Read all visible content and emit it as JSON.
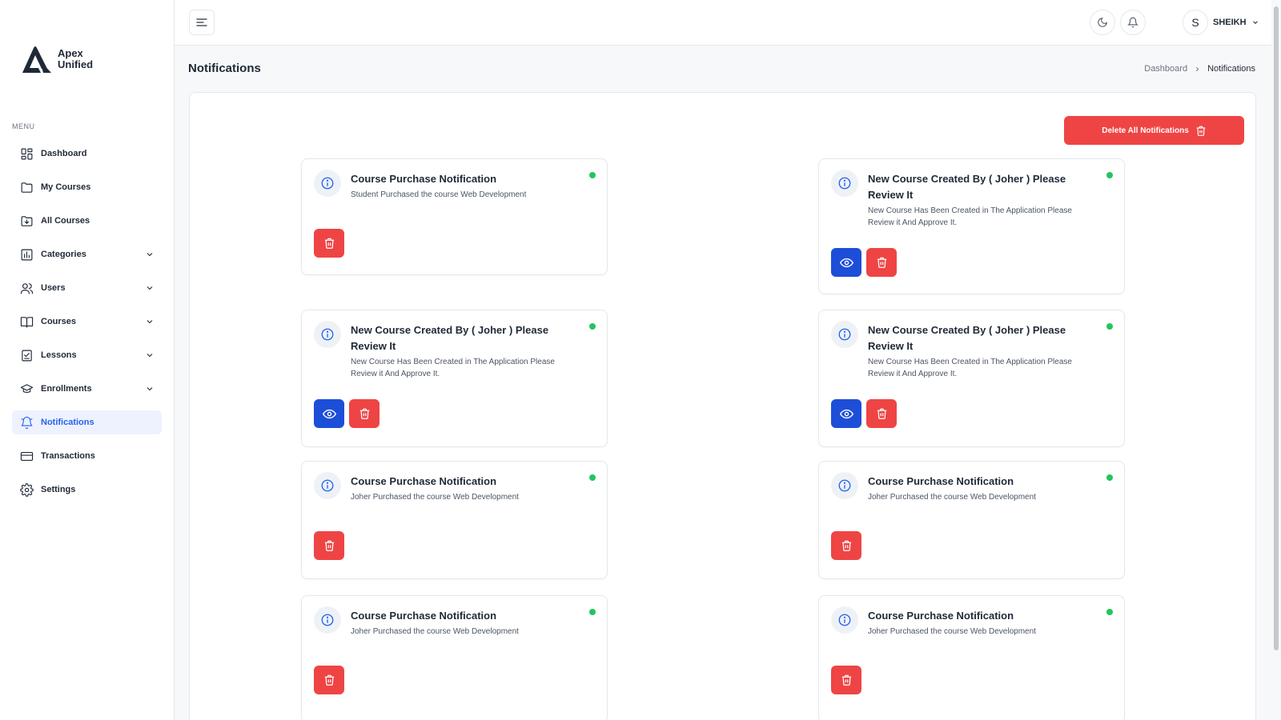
{
  "app": {
    "logo_line1": "Apex",
    "logo_line2": "Unified",
    "brand_color": "#1f2937"
  },
  "sidebar": {
    "menu_label": "MENU",
    "items": [
      {
        "label": "Dashboard",
        "icon": "grid-icon",
        "has_chevron": false,
        "active": false
      },
      {
        "label": "My Courses",
        "icon": "folder-icon",
        "has_chevron": false,
        "active": false
      },
      {
        "label": "All Courses",
        "icon": "folder-download-icon",
        "has_chevron": false,
        "active": false
      },
      {
        "label": "Categories",
        "icon": "bar-chart-icon",
        "has_chevron": true,
        "active": false
      },
      {
        "label": "Users",
        "icon": "users-icon",
        "has_chevron": true,
        "active": false
      },
      {
        "label": "Courses",
        "icon": "book-icon",
        "has_chevron": true,
        "active": false
      },
      {
        "label": "Lessons",
        "icon": "checklist-icon",
        "has_chevron": true,
        "active": false
      },
      {
        "label": "Enrollments",
        "icon": "graduation-cap-icon",
        "has_chevron": true,
        "active": false
      },
      {
        "label": "Notifications",
        "icon": "bell-icon",
        "has_chevron": false,
        "active": true
      },
      {
        "label": "Transactions",
        "icon": "credit-card-icon",
        "has_chevron": false,
        "active": false
      },
      {
        "label": "Settings",
        "icon": "gear-icon",
        "has_chevron": false,
        "active": false
      }
    ]
  },
  "header": {
    "user_initial": "S",
    "user_name": "SHEIKH"
  },
  "page": {
    "title": "Notifications",
    "breadcrumb": [
      "Dashboard",
      "Notifications"
    ]
  },
  "main": {
    "delete_all_label": "Delete All Notifications",
    "notifications": [
      {
        "title": "Course Purchase Notification",
        "body": "Student Purchased the course Web Development",
        "has_view": false,
        "unread": true
      },
      {
        "title": "New Course Created By ( Joher ) Please Review It",
        "body": "New Course Has Been Created in The Application Please Review it And Approve It.",
        "has_view": true,
        "unread": true
      },
      {
        "title": "New Course Created By ( Joher ) Please Review It",
        "body": "New Course Has Been Created in The Application Please Review it And Approve It.",
        "has_view": true,
        "unread": true
      },
      {
        "title": "New Course Created By ( Joher ) Please Review It",
        "body": "New Course Has Been Created in The Application Please Review it And Approve It.",
        "has_view": true,
        "unread": true
      },
      {
        "title": "Course Purchase Notification",
        "body": "Joher Purchased the course Web Development",
        "has_view": false,
        "unread": true
      },
      {
        "title": "Course Purchase Notification",
        "body": "Joher Purchased the course Web Development",
        "has_view": false,
        "unread": true
      },
      {
        "title": "Course Purchase Notification",
        "body": "Joher Purchased the course Web Development",
        "has_view": false,
        "unread": true
      },
      {
        "title": "Course Purchase Notification",
        "body": "Joher Purchased the course Web Development",
        "has_view": false,
        "unread": true
      }
    ]
  },
  "colors": {
    "accent": "#2563eb",
    "danger": "#ef4444",
    "view": "#1d4ed8",
    "unread_dot": "#22c55e"
  }
}
